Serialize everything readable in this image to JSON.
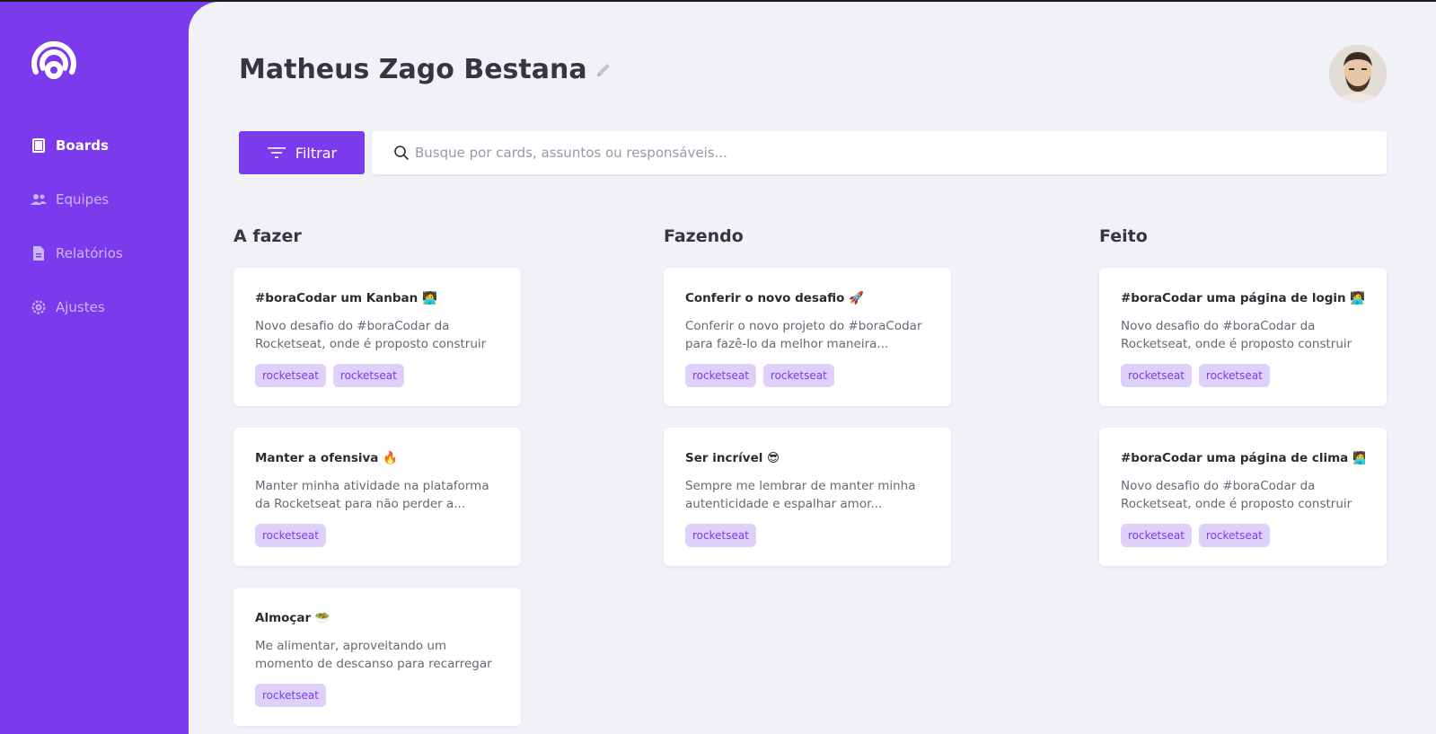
{
  "app": {
    "user_name": "Matheus Zago Bestana"
  },
  "sidebar": {
    "items": [
      {
        "label": "Boards",
        "icon": "board-icon",
        "active": true
      },
      {
        "label": "Equipes",
        "icon": "team-icon",
        "active": false
      },
      {
        "label": "Relatórios",
        "icon": "report-icon",
        "active": false
      },
      {
        "label": "Ajustes",
        "icon": "settings-icon",
        "active": false
      }
    ]
  },
  "toolbar": {
    "filter_label": "Filtrar",
    "search_placeholder": "Busque por cards, assuntos ou responsáveis..."
  },
  "columns": [
    {
      "title": "A fazer",
      "cards": [
        {
          "title": "#boraCodar um Kanban 🧑‍💻",
          "desc": "Novo desafio do #boraCodar da Rocketseat, onde é proposto construir ...",
          "tags": [
            "rocketseat",
            "rocketseat"
          ]
        },
        {
          "title": "Manter a ofensiva 🔥",
          "desc": "Manter minha atividade na plataforma da Rocketseat para não perder a...",
          "tags": [
            "rocketseat"
          ]
        },
        {
          "title": "Almoçar 🥗",
          "desc": "Me alimentar, aproveitando um momento de descanso para recarregar mi...",
          "tags": [
            "rocketseat"
          ]
        }
      ]
    },
    {
      "title": "Fazendo",
      "cards": [
        {
          "title": "Conferir o novo desafio 🚀",
          "desc": "Conferir o novo projeto do #boraCodar para fazê-lo da melhor maneira...",
          "tags": [
            "rocketseat",
            "rocketseat"
          ]
        },
        {
          "title": "Ser incrível 😎",
          "desc": "Sempre me lembrar de manter minha autenticidade e espalhar amor...",
          "tags": [
            "rocketseat"
          ]
        }
      ]
    },
    {
      "title": "Feito",
      "cards": [
        {
          "title": "#boraCodar uma página de login 🧑‍💻",
          "desc": "Novo desafio do #boraCodar da Rocketseat, onde é proposto construir ...",
          "tags": [
            "rocketseat",
            "rocketseat"
          ]
        },
        {
          "title": "#boraCodar uma página de clima 🧑‍💻",
          "desc": "Novo desafio do #boraCodar da Rocketseat, onde é proposto construir ...",
          "tags": [
            "rocketseat",
            "rocketseat"
          ]
        }
      ]
    }
  ],
  "colors": {
    "accent": "#7c3aed",
    "background": "#f0f2f7",
    "tag_bg": "#ddd0fb"
  }
}
